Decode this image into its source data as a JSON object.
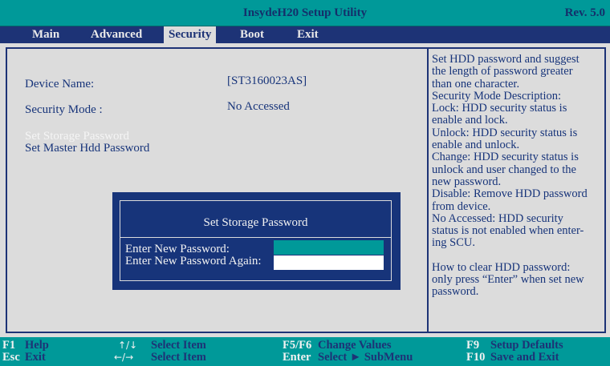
{
  "header": {
    "title": "InsydeH20 Setup Utility",
    "revision": "Rev. 5.0"
  },
  "menu": {
    "items": [
      {
        "label": "Main",
        "active": false
      },
      {
        "label": "Advanced",
        "active": false
      },
      {
        "label": "Security",
        "active": true
      },
      {
        "label": "Boot",
        "active": false
      },
      {
        "label": "Exit",
        "active": false
      }
    ]
  },
  "main": {
    "device_name_label": "Device Name:",
    "device_name_value": "[ST3160023AS]",
    "security_mode_label": "Security Mode :",
    "security_mode_value": "No Accessed",
    "set_storage_password": "Set Storage Password",
    "set_master_password": "Set Master Hdd Password"
  },
  "help": {
    "lines": [
      "Set HDD password and suggest",
      "the length of password greater",
      "than one character.",
      "Security Mode Description:",
      "Lock: HDD security status is",
      "enable and lock.",
      "Unlock: HDD security status is",
      "enable and unlock.",
      "Change: HDD security status is",
      "unlock and user changed to the",
      "new password.",
      "Disable: Remove HDD password",
      "from device.",
      "No Accessed: HDD security",
      "status is not enabled when enter-",
      "ing SCU.",
      "",
      "How to clear HDD password:",
      "only press “Enter” when set new",
      "password."
    ]
  },
  "dialog": {
    "title": "Set Storage Password",
    "new_password_label": "Enter New Password:",
    "new_password_value": "",
    "confirm_password_label": "Enter New Password Again:",
    "confirm_password_value": ""
  },
  "footer": {
    "f1_key": "F1",
    "f1_desc": "Help",
    "esc_key": "Esc",
    "esc_desc": "Exit",
    "updown_key": "↑/↓",
    "updown_desc": "Select Item",
    "leftright_key": "←/→",
    "leftright_desc": "Select Item",
    "f5f6_key": "F5/F6",
    "f5f6_desc": "Change Values",
    "enter_key": "Enter",
    "enter_desc": "Select ► SubMenu",
    "f9_key": "F9",
    "f9_desc": "Setup Defaults",
    "f10_key": "F10",
    "f10_desc": "Save and Exit"
  },
  "colors": {
    "accent_teal": "#009999",
    "navy": "#1d3376",
    "background": "#dcdcdc"
  }
}
